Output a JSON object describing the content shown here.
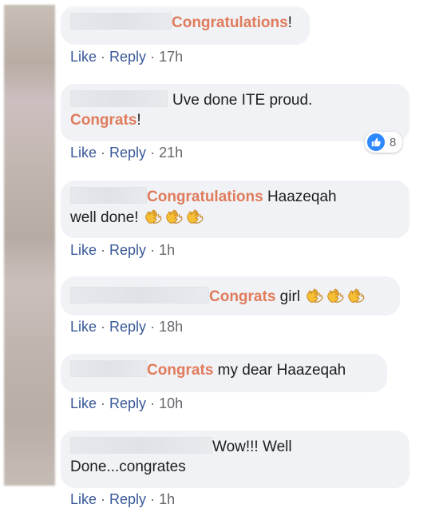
{
  "actions": {
    "like": "Like",
    "reply": "Reply",
    "separator": "·"
  },
  "comments": [
    {
      "mention": "Congratulations",
      "text": "!",
      "time": "17h"
    },
    {
      "text_line1": "Uve done ITE proud.",
      "mention": "Congrats",
      "text": "!",
      "time": "21h",
      "reaction_count": "8"
    },
    {
      "mention": "Congratulations",
      "text_line1": " Haazeqah",
      "text_line2": "well done!",
      "time": "1h"
    },
    {
      "mention": "Congrats",
      "text": " girl",
      "time": "18h"
    },
    {
      "mention": "Congrats",
      "text": " my dear Haazeqah",
      "time": "10h"
    },
    {
      "text_line1": "Wow!!! Well",
      "text_line2": "Done...congrates",
      "time": "1h"
    }
  ],
  "colors": {
    "mention": "#e07b5c",
    "link": "#385898",
    "bubble": "#f0f2f5",
    "reaction": "#2e89ff"
  },
  "icons": {
    "clap": "clapping-hands-icon",
    "like_reaction": "thumbs-up-icon"
  }
}
